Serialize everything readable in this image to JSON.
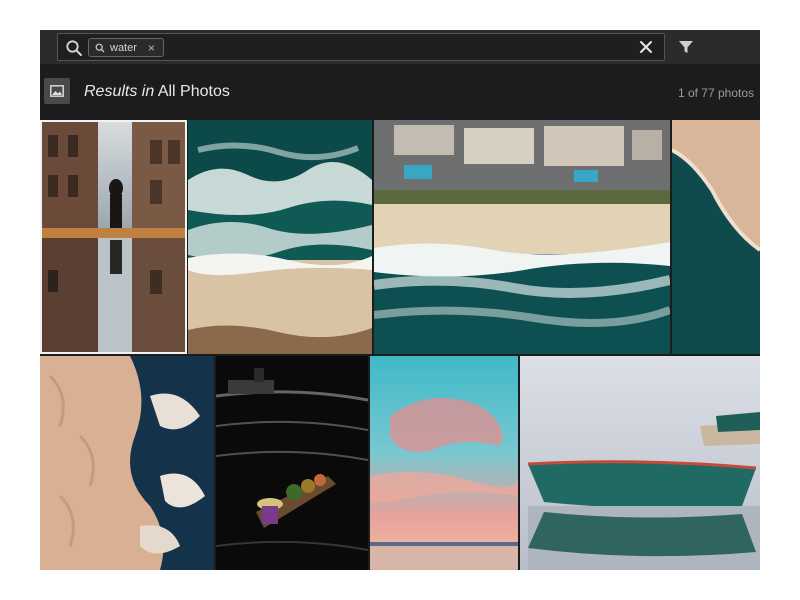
{
  "search": {
    "query_chip": "water",
    "chip_remove_glyph": "×",
    "clear_glyph": "✕"
  },
  "results": {
    "prefix": "Results in",
    "scope": "All Photos",
    "count": "1 of 77 photos"
  },
  "photos": [
    {
      "subject": "alley-reflection-photo",
      "selected": true
    },
    {
      "subject": "aerial-waves-photo",
      "selected": false
    },
    {
      "subject": "aerial-beach-resort-photo",
      "selected": false
    },
    {
      "subject": "sand-coast-photo",
      "selected": false
    },
    {
      "subject": "aerial-desert-lake-photo",
      "selected": false
    },
    {
      "subject": "boat-on-river-photo",
      "selected": false
    },
    {
      "subject": "sunset-sky-photo",
      "selected": false
    },
    {
      "subject": "green-boats-photo",
      "selected": false
    }
  ],
  "colors": {
    "app_background": "#1c1c1c",
    "search_bar": "#2b2b2b",
    "text_primary": "#e8e8e8",
    "text_secondary": "#9a9a9a",
    "selection_outline": "#f2f2f2"
  },
  "icons": {
    "search": "search-icon",
    "chip_search": "search-icon",
    "clear": "close-icon",
    "filter": "filter-icon",
    "results_thumb": "image-icon"
  }
}
